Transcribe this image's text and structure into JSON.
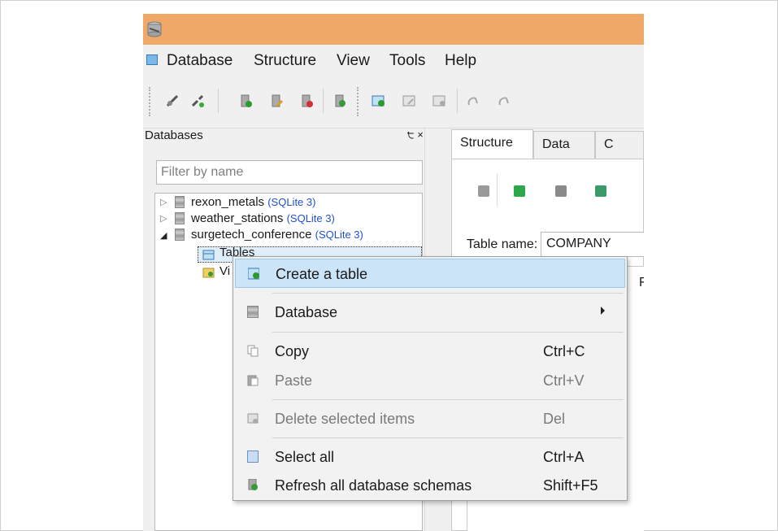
{
  "menu": [
    "Database",
    "Structure",
    "View",
    "Tools",
    "Help"
  ],
  "databases_panel": {
    "title": "Databases",
    "controls": "੮ ×",
    "filter_placeholder": "Filter by name",
    "tree": [
      {
        "name": "rexon_metals",
        "type": "(SQLite 3)",
        "expanded": false
      },
      {
        "name": "weather_stations",
        "type": "(SQLite 3)",
        "expanded": false
      },
      {
        "name": "surgetech_conference",
        "type": "(SQLite 3)",
        "expanded": true
      }
    ],
    "children": {
      "tables": "Tables",
      "views_partial": "Vi"
    }
  },
  "right": {
    "tabs": [
      "Structure",
      "Data",
      "C"
    ],
    "table_name_label": "Table name:",
    "table_name_value": "COMPANY",
    "partial_col": "F"
  },
  "context_menu": {
    "items": [
      {
        "label": "Create a table",
        "shortcut": "",
        "icon": "create-table-icon",
        "highlighted": true
      },
      {
        "label": "Database",
        "shortcut": "",
        "icon": "database-icon",
        "submenu": true
      },
      {
        "label": "Copy",
        "shortcut": "Ctrl+C",
        "icon": "copy-icon"
      },
      {
        "label": "Paste",
        "shortcut": "Ctrl+V",
        "icon": "paste-icon",
        "disabled": true
      },
      {
        "label": "Delete selected items",
        "shortcut": "Del",
        "icon": "delete-icon",
        "disabled": true
      },
      {
        "label": "Select all",
        "shortcut": "Ctrl+A",
        "icon": "select-all-icon"
      },
      {
        "label": "Refresh all database schemas",
        "shortcut": "Shift+F5",
        "icon": "refresh-icon"
      }
    ]
  },
  "colors": {
    "titlebar": "#f0a868",
    "highlight": "#cce4f7",
    "sqlite_label": "#2050d0"
  }
}
